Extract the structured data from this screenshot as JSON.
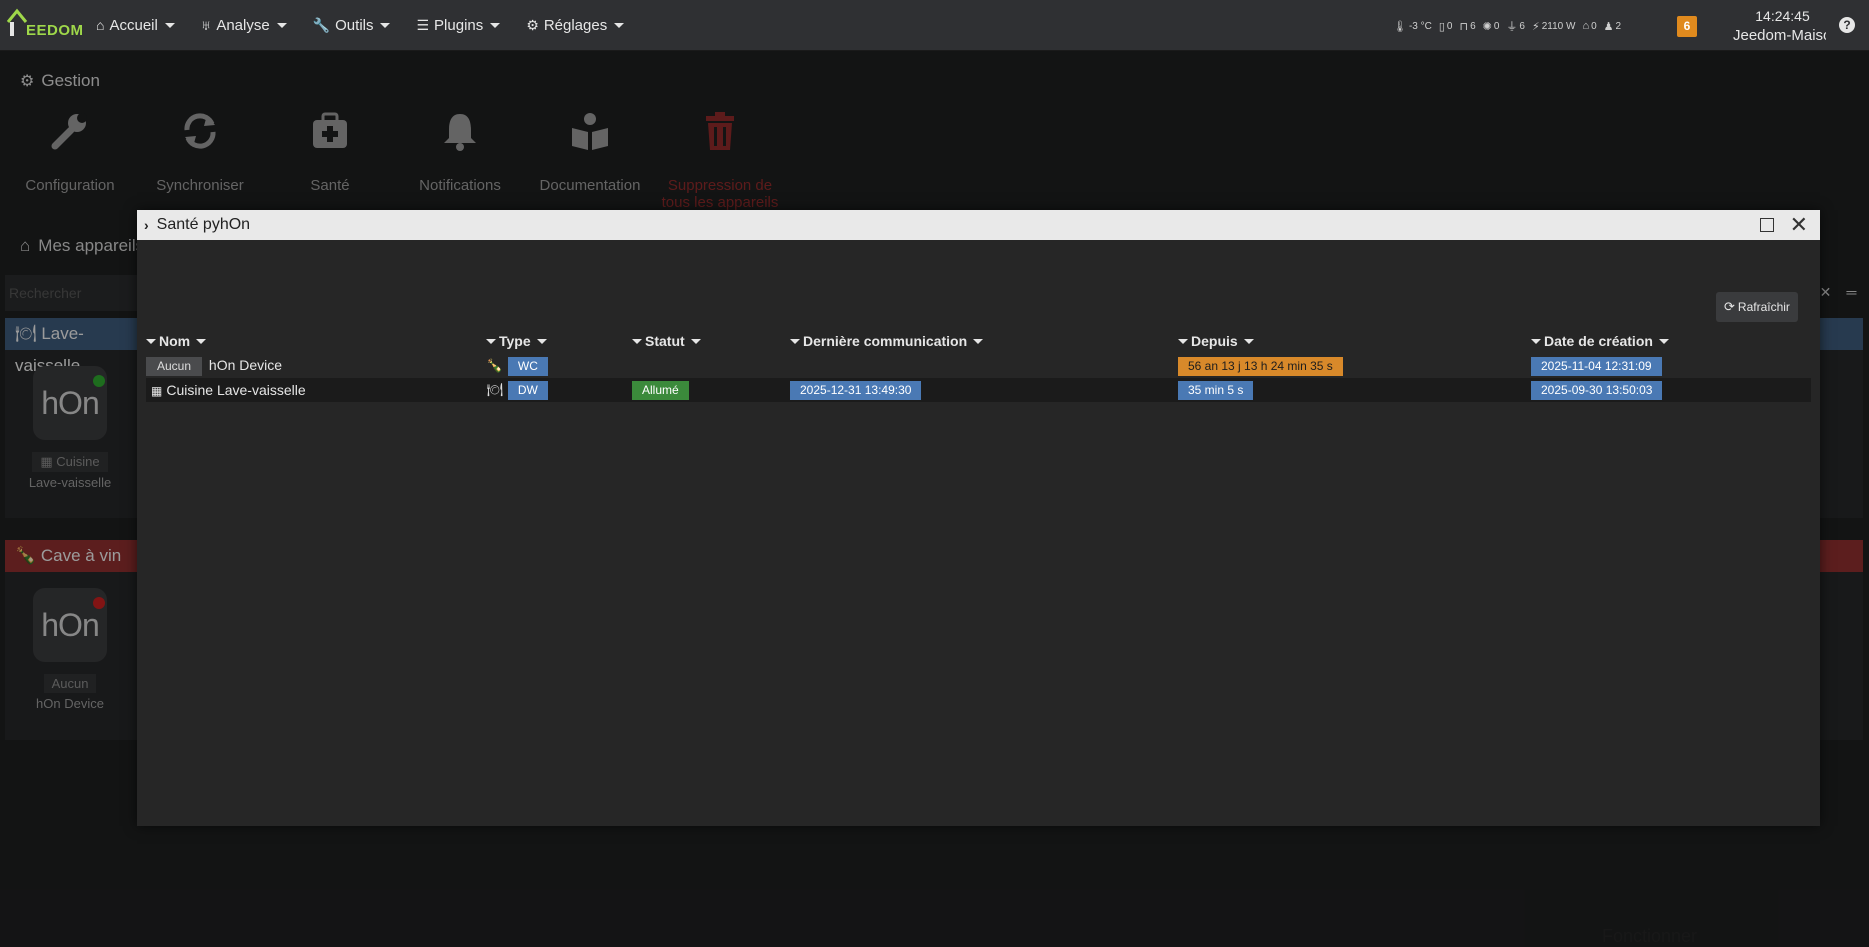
{
  "navbar": {
    "brand": "EEDOM",
    "menu": [
      {
        "label": "Accueil",
        "icon": "home-icon",
        "glyph": "⌂"
      },
      {
        "label": "Analyse",
        "icon": "stethoscope-icon",
        "glyph": "♅"
      },
      {
        "label": "Outils",
        "icon": "wrench-icon",
        "glyph": "🔧"
      },
      {
        "label": "Plugins",
        "icon": "tasks-icon",
        "glyph": "☰"
      },
      {
        "label": "Réglages",
        "icon": "gear-icon",
        "glyph": "⚙"
      }
    ],
    "status": [
      {
        "icon": "thermometer-icon",
        "glyph": "🌡",
        "value": "-3 °C"
      },
      {
        "icon": "door-icon",
        "glyph": "▯",
        "value": "0"
      },
      {
        "icon": "window-icon",
        "glyph": "⊓",
        "value": "6"
      },
      {
        "icon": "light-icon",
        "glyph": "✺",
        "value": "0"
      },
      {
        "icon": "plug-icon",
        "glyph": "⏚",
        "value": "6"
      },
      {
        "icon": "power-icon",
        "glyph": "⚡",
        "value": "2110 W"
      },
      {
        "icon": "shutter-icon",
        "glyph": "⌂",
        "value": "0"
      },
      {
        "icon": "person-icon",
        "glyph": "♟",
        "value": "2"
      }
    ],
    "messages_count": "6",
    "time": "14:24:45",
    "house_name": "Jeedom-Maison",
    "help": "?"
  },
  "background": {
    "gestion_title": "Gestion",
    "management": {
      "configuration": "Configuration",
      "sync": "Synchroniser",
      "sante": "Santé",
      "notifications": "Notifications",
      "documentation": "Documentation",
      "delete_all": "Suppression de tous les appareils"
    },
    "mes_appareils": "Mes appareils",
    "search_placeholder": "Rechercher",
    "groups": {
      "lave": {
        "title": "Lave-vaisselle",
        "device": {
          "logo": "hOn",
          "object": "Cuisine",
          "name": "Lave-vaisselle",
          "status_color": "#2ea82e"
        }
      },
      "cave": {
        "title": "Cave à vin",
        "device": {
          "logo": "hOn",
          "object": "Aucun",
          "name": "hOn Device",
          "status_color": "#c82020"
        }
      }
    },
    "footer_hint": "Fonctionner"
  },
  "modal": {
    "title": "Santé pyhOn",
    "refresh_label": "Rafraîchir",
    "columns": {
      "name": "Nom",
      "type": "Type",
      "status": "Statut",
      "last_comm": "Dernière communication",
      "since": "Depuis",
      "created": "Date de création"
    },
    "rows": [
      {
        "object": "Aucun",
        "name": "hOn Device",
        "type_icon": "wine-bottle-icon",
        "type_glyph": "🍾",
        "type": "WC",
        "status": "",
        "last_comm": "",
        "since": "56 an 13 j 13 h 24 min 35 s",
        "since_color": "#d8892a",
        "created": "2025-11-04 12:31:09"
      },
      {
        "object": "Cuisine",
        "name": "Lave-vaisselle",
        "type_icon": "utensils-icon",
        "type_glyph": "🍽",
        "type": "DW",
        "status": "Allumé",
        "last_comm": "2025-12-31 13:49:30",
        "since": "35 min 5 s",
        "since_color": "#4a79b4",
        "created": "2025-09-30 13:50:03"
      }
    ]
  }
}
